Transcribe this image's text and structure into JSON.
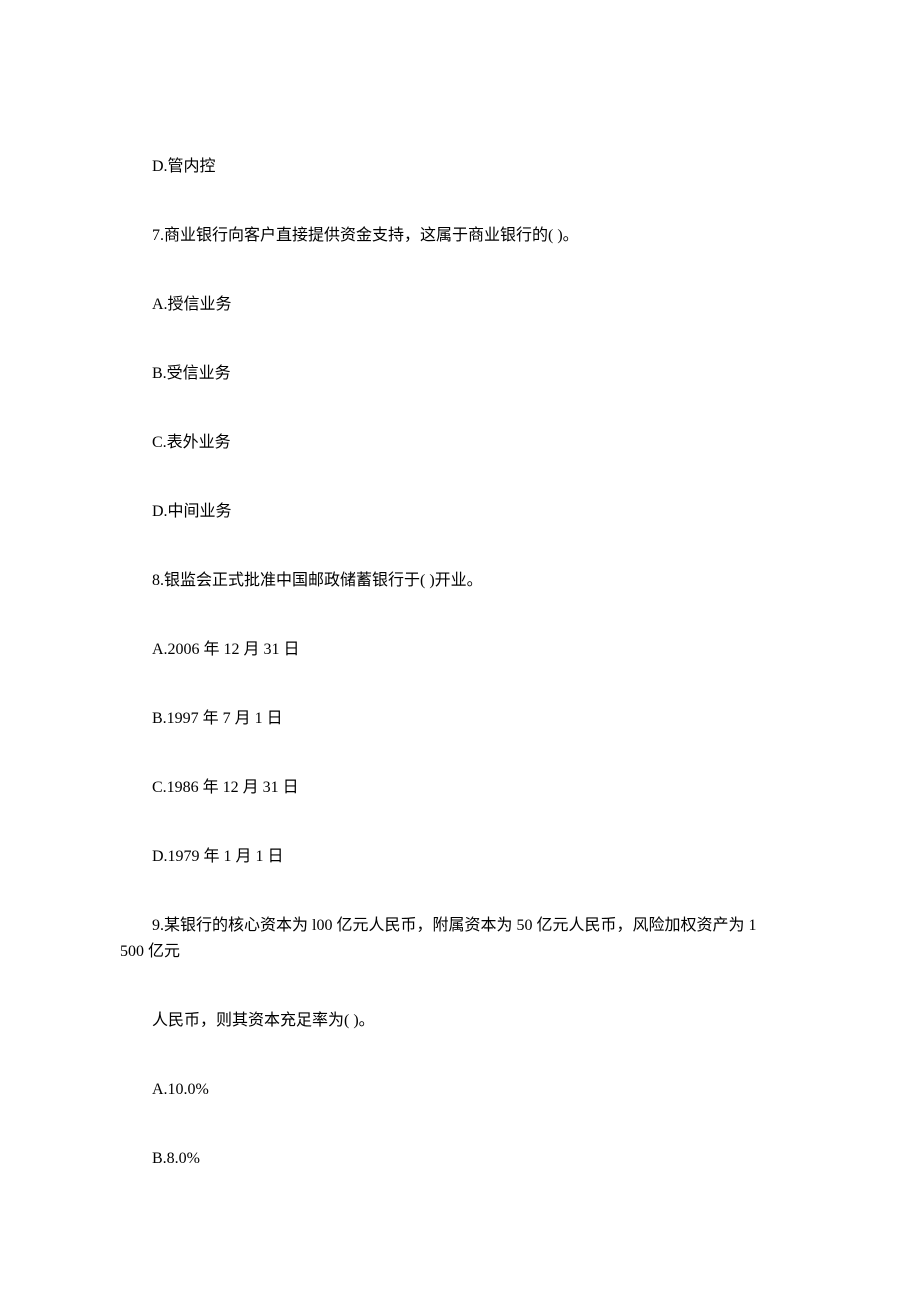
{
  "lines": {
    "d_opt6": "D.管内控",
    "q7": "7.商业银行向客户直接提供资金支持，这属于商业银行的( )。",
    "q7_a": "A.授信业务",
    "q7_b": "B.受信业务",
    "q7_c": "C.表外业务",
    "q7_d": "D.中间业务",
    "q8": "8.银监会正式批准中国邮政储蓄银行于( )开业。",
    "q8_a": "A.2006 年 12 月 31 日",
    "q8_b": "B.1997 年 7 月 1 日",
    "q8_c": "C.1986 年 12 月 31 日",
    "q8_d": "D.1979 年 1 月 1 日",
    "q9_l1": "9.某银行的核心资本为 l00 亿元人民币，附属资本为 50 亿元人民币，风险加权资产为 1",
    "q9_l2": "500 亿元",
    "q9_l3": "人民币，则其资本充足率为( )。",
    "q9_a": "A.10.0%",
    "q9_b": "B.8.0%"
  }
}
